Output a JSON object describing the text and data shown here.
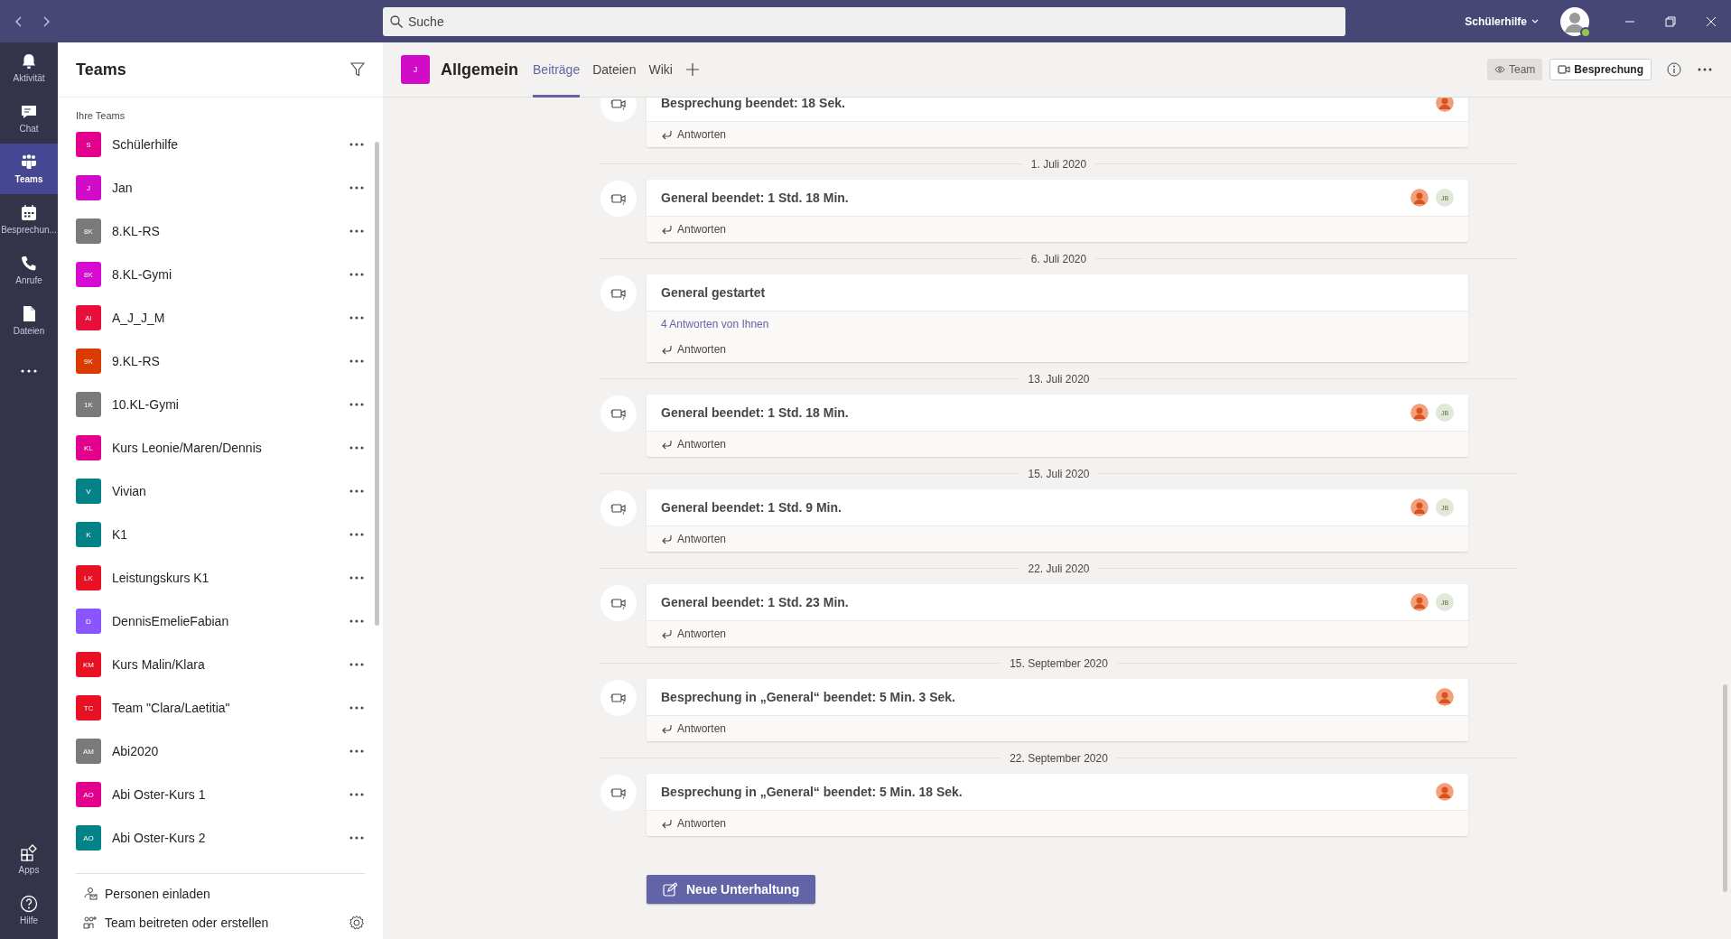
{
  "top_bar": {
    "search": {
      "placeholder": "Suche"
    },
    "account": {
      "name": "Schülerhilfe",
      "online": true
    }
  },
  "rail": [
    {
      "kind": "bell",
      "label": "Aktivität",
      "selected": false
    },
    {
      "kind": "chat",
      "label": "Chat",
      "selected": false
    },
    {
      "kind": "teams",
      "label": "Teams",
      "selected": true
    },
    {
      "kind": "calendar",
      "label": "Besprechun...",
      "selected": false
    },
    {
      "kind": "phone",
      "label": "Anrufe",
      "selected": false
    },
    {
      "kind": "file",
      "label": "Dateien",
      "selected": false
    },
    {
      "kind": "more",
      "selected": false
    }
  ],
  "rail_bottom": [
    {
      "kind": "apps",
      "label": "Apps",
      "selected": false
    },
    {
      "kind": "help",
      "label": "Hilfe",
      "selected": false
    }
  ],
  "team_panel": {
    "title": "Teams",
    "section": "Ihre Teams",
    "teams": [
      {
        "initials": "S",
        "name": "Schülerhilfe",
        "color": "#e3008c"
      },
      {
        "initials": "J",
        "name": "Jan",
        "color": "#d20bc8"
      },
      {
        "initials": "8K",
        "name": "8.KL-RS",
        "color": "#7a7a7a"
      },
      {
        "initials": "8K",
        "name": "8.KL-Gymi",
        "color": "#d60ad0"
      },
      {
        "initials": "AI",
        "name": "A_J_J_M",
        "color": "#e8103a"
      },
      {
        "initials": "9K",
        "name": "9.KL-RS",
        "color": "#da3b01"
      },
      {
        "initials": "1K",
        "name": "10.KL-Gymi",
        "color": "#7a7a7a"
      },
      {
        "initials": "KL",
        "name": "Kurs Leonie/Maren/Dennis",
        "color": "#e3008c"
      },
      {
        "initials": "V",
        "name": "Vivian",
        "color": "#038387"
      },
      {
        "initials": "K",
        "name": "K1",
        "color": "#038387"
      },
      {
        "initials": "LK",
        "name": "Leistungskurs K1",
        "color": "#e81123"
      },
      {
        "initials": "D",
        "name": "DennisEmelieFabian",
        "color": "#8a55ff"
      },
      {
        "initials": "KM",
        "name": "Kurs Malin/Klara",
        "color": "#e81123"
      },
      {
        "initials": "TC",
        "name": "Team \"Clara/Laetitia\"",
        "color": "#e81123"
      },
      {
        "initials": "AM",
        "name": "Abi2020",
        "color": "#7a7a7a"
      },
      {
        "initials": "AO",
        "name": "Abi Oster-Kurs 1",
        "color": "#e3008c"
      },
      {
        "initials": "AO",
        "name": "Abi Oster-Kurs 2",
        "color": "#038387"
      }
    ],
    "footer": [
      {
        "kind": "invite",
        "label": "Personen einladen"
      },
      {
        "kind": "join",
        "label": "Team beitreten oder erstellen"
      }
    ]
  },
  "channel": {
    "initials": "J",
    "color": "#d20bc8",
    "name": "Allgemein",
    "tabs": [
      {
        "label": "Beiträge",
        "selected": true
      },
      {
        "label": "Dateien",
        "selected": false
      },
      {
        "label": "Wiki",
        "selected": false
      }
    ],
    "team_button": "Team",
    "meeting_button": "Besprechung"
  },
  "feed": [
    {
      "kind": "post",
      "title": "Besprechung beendet: 18 Sek.",
      "participants": [
        {
          "kind": "picture"
        }
      ],
      "reply": "Antworten"
    },
    {
      "kind": "date",
      "label": "1. Juli 2020"
    },
    {
      "kind": "post",
      "title": "General beendet: 1 Std. 18 Min.",
      "participants": [
        {
          "kind": "picture"
        },
        {
          "kind": "initials",
          "initials": "JB"
        }
      ],
      "reply": "Antworten"
    },
    {
      "kind": "date",
      "label": "6. Juli 2020"
    },
    {
      "kind": "post",
      "title": "General gestartet",
      "replies_link": "4 Antworten von Ihnen",
      "reply": "Antworten"
    },
    {
      "kind": "date",
      "label": "13. Juli 2020"
    },
    {
      "kind": "post",
      "title": "General beendet: 1 Std. 18 Min.",
      "participants": [
        {
          "kind": "picture"
        },
        {
          "kind": "initials",
          "initials": "JB"
        }
      ],
      "reply": "Antworten"
    },
    {
      "kind": "date",
      "label": "15. Juli 2020"
    },
    {
      "kind": "post",
      "title": "General beendet: 1 Std. 9 Min.",
      "participants": [
        {
          "kind": "picture"
        },
        {
          "kind": "initials",
          "initials": "JB"
        }
      ],
      "reply": "Antworten"
    },
    {
      "kind": "date",
      "label": "22. Juli 2020"
    },
    {
      "kind": "post",
      "title": "General beendet: 1 Std. 23 Min.",
      "participants": [
        {
          "kind": "picture"
        },
        {
          "kind": "initials",
          "initials": "JB"
        }
      ],
      "reply": "Antworten"
    },
    {
      "kind": "date",
      "label": "15. September 2020"
    },
    {
      "kind": "post",
      "title": "Besprechung in „General“ beendet: 5 Min. 3 Sek.",
      "participants": [
        {
          "kind": "picture"
        }
      ],
      "reply": "Antworten"
    },
    {
      "kind": "date",
      "label": "22. September 2020"
    },
    {
      "kind": "post",
      "title": "Besprechung in „General“ beendet: 5 Min. 18 Sek.",
      "participants": [
        {
          "kind": "picture"
        }
      ],
      "reply": "Antworten"
    }
  ],
  "new_conversation": "Neue Unterhaltung"
}
